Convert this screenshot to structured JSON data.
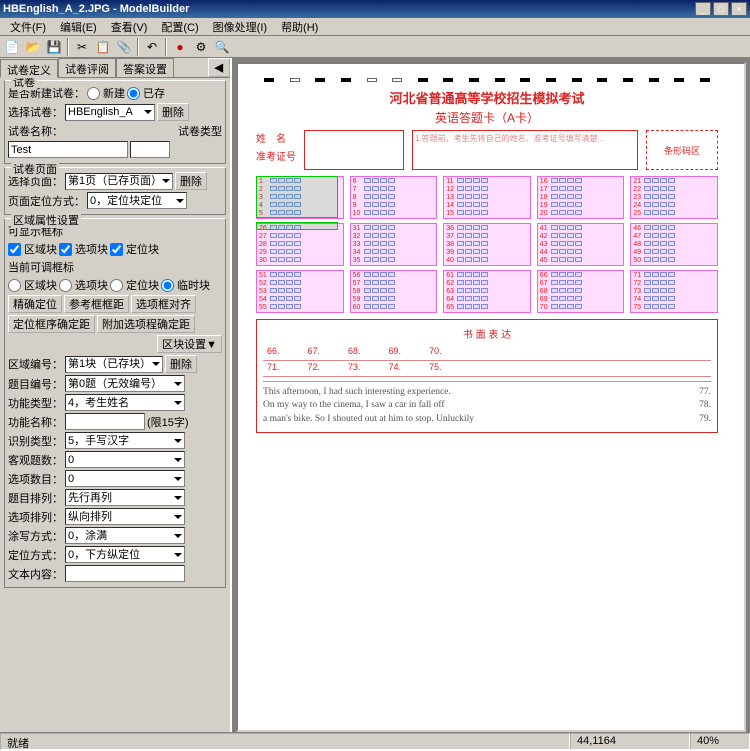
{
  "title": "HBEnglish_A_2.JPG - ModelBuilder",
  "menu": [
    "文件(F)",
    "编辑(E)",
    "查看(V)",
    "配置(C)",
    "图像处理(I)",
    "帮助(H)"
  ],
  "toolbar_icons": [
    "new",
    "open",
    "save",
    "",
    "cut",
    "copy",
    "paste",
    "",
    "undo",
    "",
    "run",
    "stop",
    "",
    "zoom-in",
    "zoom-out"
  ],
  "tabs": {
    "items": [
      "试卷定义",
      "试卷评阅",
      "答案设置"
    ],
    "active": 0
  },
  "g_paper": {
    "title": "试卷",
    "new_label": "是否新建试卷：",
    "opt_new": "新建",
    "opt_exist": "已存",
    "is_exist": true,
    "select_label": "选择试卷：",
    "select_val": "HBEnglish_A",
    "btn_del": "删除",
    "name_label": "试卷名称：",
    "type_label": "试卷类型",
    "name_val": "Test"
  },
  "g_page": {
    "title": "试卷页面",
    "page_label": "选择页面：",
    "page_val": "第1页（已存页面）",
    "btn_del": "删除",
    "pos_label": "页面定位方式：",
    "pos_val": "0，定位块定位"
  },
  "g_region": {
    "title": "区域属性设置",
    "show_label": "可显示框标",
    "cb_region": "区域块",
    "cb_option": "选项块",
    "cb_loc": "定位块",
    "edit_label": "当前可调框标",
    "rb_region": "区域块",
    "rb_option": "选项块",
    "rb_loc": "定位块",
    "rb_temp": "临时块",
    "btn_precise": "精确定位",
    "btn_refrect": "参考框框距",
    "btn_align": "选项框对齐",
    "btn_locarr": "定位框序确定距",
    "btn_addopt": "附加选项程确定距",
    "btn_regcfg": "区块设置▼",
    "reg_no_label": "区域编号：",
    "reg_no_val": "第1块（已存块）",
    "btn_del": "删除",
    "q_no_label": "题目编号：",
    "q_no_val": "第0题（无效编号）",
    "func_type_label": "功能类型：",
    "func_type_val": "4，考生姓名",
    "func_name_label": "功能名称：",
    "func_name_limit": "(限15字)",
    "rec_type_label": "识别类型：",
    "rec_type_val": "5，手写汉字",
    "obj_cnt_label": "客观题数：",
    "obj_cnt_val": "0",
    "opt_cnt_label": "选项数目：",
    "opt_cnt_val": "0",
    "q_arr_label": "题目排列：",
    "q_arr_val": "先行再列",
    "opt_arr_label": "选项排列：",
    "opt_arr_val": "纵向排列",
    "smear_label": "涂写方式：",
    "smear_val": "0，涂满",
    "loc_label": "定位方式：",
    "loc_val": "0，下方纵定位",
    "txt_label": "文本内容："
  },
  "sheet": {
    "title": "河北省普通高等学校招生模拟考试",
    "subtitle": "英语答题卡（A卡）",
    "name_label": "姓　名",
    "id_label": "准考证号",
    "barcode": "条形码区",
    "written_title": "书 面 表 达",
    "wnums_a": [
      "66.",
      "67.",
      "68.",
      "69.",
      "70."
    ],
    "wnums_b": [
      "71.",
      "72.",
      "73.",
      "74.",
      "75."
    ],
    "essay": [
      "This afternoon, I had such interesting experience.",
      "On my way to the cinema, I saw a car in fall off",
      "a man's bike. So I shouted out at him to stop. Unluckily"
    ],
    "essay_nums": [
      "77.",
      "78.",
      "79."
    ]
  },
  "status": {
    "ready": "就绪",
    "coords": "44,1164",
    "zoom": "40%"
  },
  "nav_btn": "◀"
}
